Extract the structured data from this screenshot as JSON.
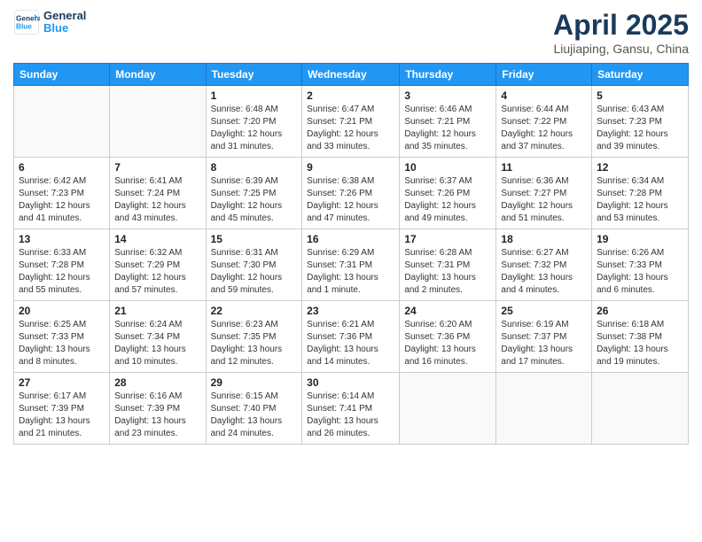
{
  "logo": {
    "text_general": "General",
    "text_blue": "Blue"
  },
  "title": "April 2025",
  "location": "Liujiaping, Gansu, China",
  "days_of_week": [
    "Sunday",
    "Monday",
    "Tuesday",
    "Wednesday",
    "Thursday",
    "Friday",
    "Saturday"
  ],
  "weeks": [
    [
      {
        "day": "",
        "info": ""
      },
      {
        "day": "",
        "info": ""
      },
      {
        "day": "1",
        "info": "Sunrise: 6:48 AM\nSunset: 7:20 PM\nDaylight: 12 hours\nand 31 minutes."
      },
      {
        "day": "2",
        "info": "Sunrise: 6:47 AM\nSunset: 7:21 PM\nDaylight: 12 hours\nand 33 minutes."
      },
      {
        "day": "3",
        "info": "Sunrise: 6:46 AM\nSunset: 7:21 PM\nDaylight: 12 hours\nand 35 minutes."
      },
      {
        "day": "4",
        "info": "Sunrise: 6:44 AM\nSunset: 7:22 PM\nDaylight: 12 hours\nand 37 minutes."
      },
      {
        "day": "5",
        "info": "Sunrise: 6:43 AM\nSunset: 7:23 PM\nDaylight: 12 hours\nand 39 minutes."
      }
    ],
    [
      {
        "day": "6",
        "info": "Sunrise: 6:42 AM\nSunset: 7:23 PM\nDaylight: 12 hours\nand 41 minutes."
      },
      {
        "day": "7",
        "info": "Sunrise: 6:41 AM\nSunset: 7:24 PM\nDaylight: 12 hours\nand 43 minutes."
      },
      {
        "day": "8",
        "info": "Sunrise: 6:39 AM\nSunset: 7:25 PM\nDaylight: 12 hours\nand 45 minutes."
      },
      {
        "day": "9",
        "info": "Sunrise: 6:38 AM\nSunset: 7:26 PM\nDaylight: 12 hours\nand 47 minutes."
      },
      {
        "day": "10",
        "info": "Sunrise: 6:37 AM\nSunset: 7:26 PM\nDaylight: 12 hours\nand 49 minutes."
      },
      {
        "day": "11",
        "info": "Sunrise: 6:36 AM\nSunset: 7:27 PM\nDaylight: 12 hours\nand 51 minutes."
      },
      {
        "day": "12",
        "info": "Sunrise: 6:34 AM\nSunset: 7:28 PM\nDaylight: 12 hours\nand 53 minutes."
      }
    ],
    [
      {
        "day": "13",
        "info": "Sunrise: 6:33 AM\nSunset: 7:28 PM\nDaylight: 12 hours\nand 55 minutes."
      },
      {
        "day": "14",
        "info": "Sunrise: 6:32 AM\nSunset: 7:29 PM\nDaylight: 12 hours\nand 57 minutes."
      },
      {
        "day": "15",
        "info": "Sunrise: 6:31 AM\nSunset: 7:30 PM\nDaylight: 12 hours\nand 59 minutes."
      },
      {
        "day": "16",
        "info": "Sunrise: 6:29 AM\nSunset: 7:31 PM\nDaylight: 13 hours\nand 1 minute."
      },
      {
        "day": "17",
        "info": "Sunrise: 6:28 AM\nSunset: 7:31 PM\nDaylight: 13 hours\nand 2 minutes."
      },
      {
        "day": "18",
        "info": "Sunrise: 6:27 AM\nSunset: 7:32 PM\nDaylight: 13 hours\nand 4 minutes."
      },
      {
        "day": "19",
        "info": "Sunrise: 6:26 AM\nSunset: 7:33 PM\nDaylight: 13 hours\nand 6 minutes."
      }
    ],
    [
      {
        "day": "20",
        "info": "Sunrise: 6:25 AM\nSunset: 7:33 PM\nDaylight: 13 hours\nand 8 minutes."
      },
      {
        "day": "21",
        "info": "Sunrise: 6:24 AM\nSunset: 7:34 PM\nDaylight: 13 hours\nand 10 minutes."
      },
      {
        "day": "22",
        "info": "Sunrise: 6:23 AM\nSunset: 7:35 PM\nDaylight: 13 hours\nand 12 minutes."
      },
      {
        "day": "23",
        "info": "Sunrise: 6:21 AM\nSunset: 7:36 PM\nDaylight: 13 hours\nand 14 minutes."
      },
      {
        "day": "24",
        "info": "Sunrise: 6:20 AM\nSunset: 7:36 PM\nDaylight: 13 hours\nand 16 minutes."
      },
      {
        "day": "25",
        "info": "Sunrise: 6:19 AM\nSunset: 7:37 PM\nDaylight: 13 hours\nand 17 minutes."
      },
      {
        "day": "26",
        "info": "Sunrise: 6:18 AM\nSunset: 7:38 PM\nDaylight: 13 hours\nand 19 minutes."
      }
    ],
    [
      {
        "day": "27",
        "info": "Sunrise: 6:17 AM\nSunset: 7:39 PM\nDaylight: 13 hours\nand 21 minutes."
      },
      {
        "day": "28",
        "info": "Sunrise: 6:16 AM\nSunset: 7:39 PM\nDaylight: 13 hours\nand 23 minutes."
      },
      {
        "day": "29",
        "info": "Sunrise: 6:15 AM\nSunset: 7:40 PM\nDaylight: 13 hours\nand 24 minutes."
      },
      {
        "day": "30",
        "info": "Sunrise: 6:14 AM\nSunset: 7:41 PM\nDaylight: 13 hours\nand 26 minutes."
      },
      {
        "day": "",
        "info": ""
      },
      {
        "day": "",
        "info": ""
      },
      {
        "day": "",
        "info": ""
      }
    ]
  ]
}
